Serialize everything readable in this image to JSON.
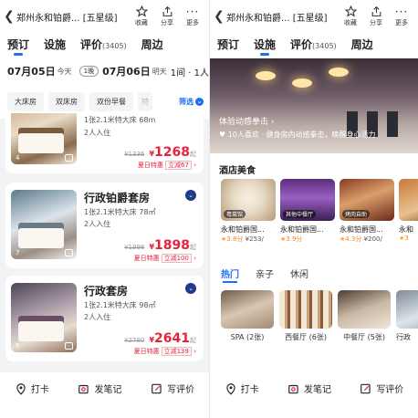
{
  "header": {
    "back_icon": "chevron-left-icon",
    "hotel_name": "郑州永和铂爵... [五星级]",
    "favorite_label": "收藏",
    "share_label": "分享",
    "more_label": "更多"
  },
  "tabs": [
    {
      "label": "预订"
    },
    {
      "label": "设施"
    },
    {
      "label": "评价",
      "count": "(3405)"
    },
    {
      "label": "周边"
    }
  ],
  "left": {
    "active_tab": "预订",
    "checkin_date": "07月05日",
    "checkin_day": "今天",
    "nights": "1晚",
    "checkout_date": "07月06日",
    "checkout_day": "明天",
    "guests": "1间 · 1人",
    "filters": [
      "大床房",
      "双床房",
      "双份早餐",
      "特"
    ],
    "filter_button": "筛选",
    "rooms": [
      {
        "desc1": "1张2.1米特大床 68m",
        "desc2": "2人入住",
        "original_price": "¥1336",
        "price": "1268",
        "price_suffix": "起",
        "promo_tag": "夏日特惠",
        "promo_discount": "立减67",
        "image_count": "4"
      },
      {
        "name": "行政铂爵套房",
        "desc1": "1张2.1米特大床 78㎡",
        "desc2": "2人入住",
        "original_price": "¥1998",
        "price": "1898",
        "price_suffix": "起",
        "promo_tag": "夏日特惠",
        "promo_discount": "立减100",
        "image_count": "7"
      },
      {
        "name": "行政套房",
        "desc1": "1张2.1米特大床 98㎡",
        "desc2": "2人入住",
        "original_price": "¥2780",
        "price": "2641",
        "price_suffix": "起",
        "promo_tag": "夏日特惠",
        "promo_discount": "立减139",
        "image_count": "5"
      }
    ]
  },
  "right": {
    "active_tab": "设施",
    "hero_title": "体验动感拳击",
    "hero_likes": "10人喜欢",
    "hero_caption": "健身房内动感拳击，唤醒身心活力",
    "dining_title": "酒店美食",
    "restaurants": [
      {
        "tag": "粤菜馆",
        "name": "永和铂爵国...",
        "score": "3.8分",
        "cost": "¥253/"
      },
      {
        "tag": "其他中餐厅",
        "name": "永和铂爵国...",
        "score": "3.9分",
        "cost": ""
      },
      {
        "tag": "烤肉自助",
        "name": "永和铂爵国...",
        "score": "4.3分",
        "cost": "¥200/"
      },
      {
        "tag": "",
        "name": "永和",
        "score": "3",
        "cost": ""
      }
    ],
    "photo_tabs": [
      "热门",
      "亲子",
      "休闲"
    ],
    "photos": [
      {
        "caption": "SPA (2张)"
      },
      {
        "caption": "西餐厅 (6张)"
      },
      {
        "caption": "中餐厅 (5张)"
      },
      {
        "caption": "行政"
      }
    ]
  },
  "bottom_bar": {
    "checkin_label": "打卡",
    "post_label": "发笔记",
    "review_label": "写评价"
  },
  "colors": {
    "accent": "#1f6fef",
    "price_red": "#e3243b",
    "star": "#f5a623"
  }
}
